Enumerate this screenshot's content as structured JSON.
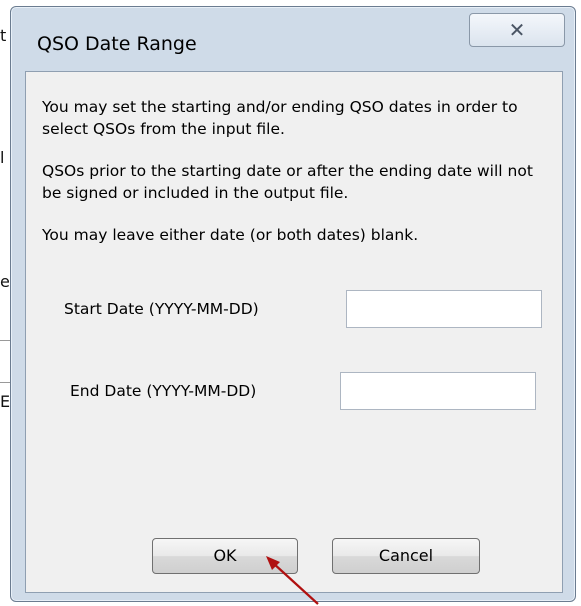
{
  "background": {
    "fragments": [
      "t",
      "l",
      "e",
      "E"
    ]
  },
  "dialog": {
    "title": "QSO Date Range",
    "close_glyph": "✕",
    "paragraphs": [
      "You may set the starting and/or ending QSO dates in order to select QSOs from the input file.",
      "QSOs prior to the starting date or after the ending date will not be signed or included in the output file.",
      "You may leave either date (or both dates) blank."
    ],
    "start_date": {
      "label": "Start Date (YYYY-MM-DD)",
      "value": ""
    },
    "end_date": {
      "label": "End Date (YYYY-MM-DD)",
      "value": ""
    },
    "ok_label": "OK",
    "cancel_label": "Cancel"
  },
  "colors": {
    "frame": "#cfdbe8",
    "client": "#f0f0f0",
    "annotation_arrow": "#b01010"
  },
  "icons": {
    "close": "close-icon",
    "annotation": "red-arrow-annotation"
  }
}
